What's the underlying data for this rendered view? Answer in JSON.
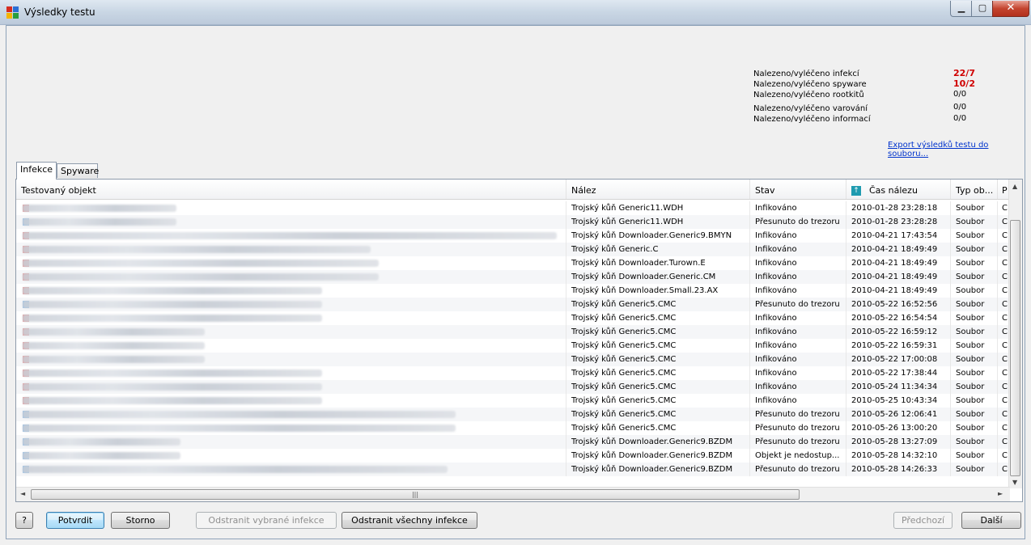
{
  "window": {
    "title": "Výsledky testu"
  },
  "stats": [
    {
      "label": "Nalezeno/vyléčeno infekcí",
      "value": "22/7",
      "highlight": true
    },
    {
      "label": "Nalezeno/vyléčeno spyware",
      "value": "10/2",
      "highlight": true
    },
    {
      "label": "Nalezeno/vyléčeno rootkitů",
      "value": "0/0",
      "highlight": false
    },
    {
      "label": "Nalezeno/vyléčeno varování",
      "value": "0/0",
      "highlight": false
    },
    {
      "label": "Nalezeno/vyléčeno informací",
      "value": "0/0",
      "highlight": false
    }
  ],
  "export_link": "Export výsledků testu do souboru...",
  "tabs": [
    "Infekce",
    "Spyware"
  ],
  "columns": [
    "Testovaný objekt",
    "Nález",
    "Stav",
    "Čas nálezu",
    "Typ ob...",
    "P"
  ],
  "rows": [
    {
      "finding": "Trojský kůň Generic11.WDH",
      "status": "Infikováno",
      "time": "2010-01-28 23:28:18",
      "type": "Soubor",
      "p": "C"
    },
    {
      "finding": "Trojský kůň Generic11.WDH",
      "status": "Přesunuto do trezoru",
      "time": "2010-01-28 23:28:28",
      "type": "Soubor",
      "p": "C"
    },
    {
      "finding": "Trojský kůň Downloader.Generic9.BMYN",
      "status": "Infikováno",
      "time": "2010-04-21 17:43:54",
      "type": "Soubor",
      "p": "C"
    },
    {
      "finding": "Trojský kůň Generic.C",
      "status": "Infikováno",
      "time": "2010-04-21 18:49:49",
      "type": "Soubor",
      "p": "C"
    },
    {
      "finding": "Trojský kůň Downloader.Turown.E",
      "status": "Infikováno",
      "time": "2010-04-21 18:49:49",
      "type": "Soubor",
      "p": "C"
    },
    {
      "finding": "Trojský kůň Downloader.Generic.CM",
      "status": "Infikováno",
      "time": "2010-04-21 18:49:49",
      "type": "Soubor",
      "p": "C"
    },
    {
      "finding": "Trojský kůň Downloader.Small.23.AX",
      "status": "Infikováno",
      "time": "2010-04-21 18:49:49",
      "type": "Soubor",
      "p": "C"
    },
    {
      "finding": "Trojský kůň Generic5.CMC",
      "status": "Přesunuto do trezoru",
      "time": "2010-05-22 16:52:56",
      "type": "Soubor",
      "p": "C"
    },
    {
      "finding": "Trojský kůň Generic5.CMC",
      "status": "Infikováno",
      "time": "2010-05-22 16:54:54",
      "type": "Soubor",
      "p": "C"
    },
    {
      "finding": "Trojský kůň Generic5.CMC",
      "status": "Infikováno",
      "time": "2010-05-22 16:59:12",
      "type": "Soubor",
      "p": "C"
    },
    {
      "finding": "Trojský kůň Generic5.CMC",
      "status": "Infikováno",
      "time": "2010-05-22 16:59:31",
      "type": "Soubor",
      "p": "C"
    },
    {
      "finding": "Trojský kůň Generic5.CMC",
      "status": "Infikováno",
      "time": "2010-05-22 17:00:08",
      "type": "Soubor",
      "p": "C"
    },
    {
      "finding": "Trojský kůň Generic5.CMC",
      "status": "Infikováno",
      "time": "2010-05-22 17:38:44",
      "type": "Soubor",
      "p": "C"
    },
    {
      "finding": "Trojský kůň Generic5.CMC",
      "status": "Infikováno",
      "time": "2010-05-24 11:34:34",
      "type": "Soubor",
      "p": "C"
    },
    {
      "finding": "Trojský kůň Generic5.CMC",
      "status": "Infikováno",
      "time": "2010-05-25 10:43:34",
      "type": "Soubor",
      "p": "C"
    },
    {
      "finding": "Trojský kůň Generic5.CMC",
      "status": "Přesunuto do trezoru",
      "time": "2010-05-26 12:06:41",
      "type": "Soubor",
      "p": "C"
    },
    {
      "finding": "Trojský kůň Generic5.CMC",
      "status": "Přesunuto do trezoru",
      "time": "2010-05-26 13:00:20",
      "type": "Soubor",
      "p": "C"
    },
    {
      "finding": "Trojský kůň Downloader.Generic9.BZDM",
      "status": "Přesunuto do trezoru",
      "time": "2010-05-28 13:27:09",
      "type": "Soubor",
      "p": "C"
    },
    {
      "finding": "Trojský kůň Downloader.Generic9.BZDM",
      "status": "Objekt je nedostup...",
      "time": "2010-05-28 14:32:10",
      "type": "Soubor",
      "p": "C"
    },
    {
      "finding": "Trojský kůň Downloader.Generic9.BZDM",
      "status": "Přesunuto do trezoru",
      "time": "2010-05-28 14:26:33",
      "type": "Soubor",
      "p": "C"
    }
  ],
  "buttons": {
    "help": "?",
    "confirm": "Potvrdit",
    "cancel": "Storno",
    "remove_selected": "Odstranit vybrané infekce",
    "remove_all": "Odstranit všechny infekce",
    "previous": "Předchozí",
    "next": "Další"
  }
}
